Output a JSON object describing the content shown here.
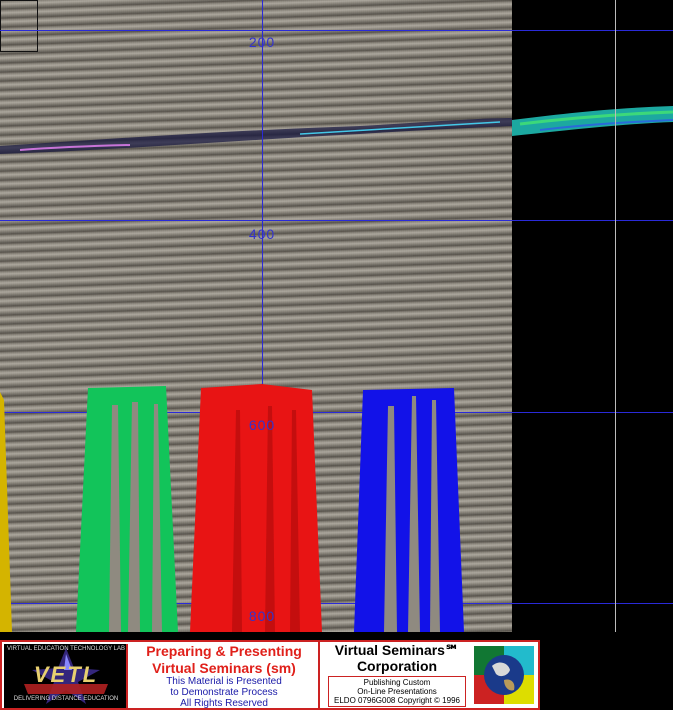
{
  "seismic_view": {
    "depth_labels": [
      "200",
      "400",
      "600",
      "800"
    ],
    "grid_color": "#2a2ad8",
    "bar_colors": [
      "#d4b400",
      "#12c45a",
      "#e81414",
      "#1212e8"
    ]
  },
  "banner": {
    "logo": {
      "text": "VETL",
      "top_text": "VIRTUAL EDUCATION TECHNOLOGY LAB",
      "bottom_text": "DELIVERING DISTANCE EDUCATION"
    },
    "middle": {
      "title_line1": "Preparing & Presenting",
      "title_line2": "Virtual Seminars (sm)",
      "line1": "This Material is Presented",
      "line2": "to Demonstrate Process",
      "line3": "All Rights Reserved"
    },
    "right": {
      "title_line1": "Virtual Seminars℠",
      "title_line2": "Corporation",
      "line1": "Publishing Custom",
      "line2": "On-Line Presentations",
      "line3": "ELDO 0796G008 Copyright © 1996"
    },
    "globe_colors": [
      "#22bbcc",
      "#cc2222",
      "#117733",
      "#dddd00"
    ]
  }
}
